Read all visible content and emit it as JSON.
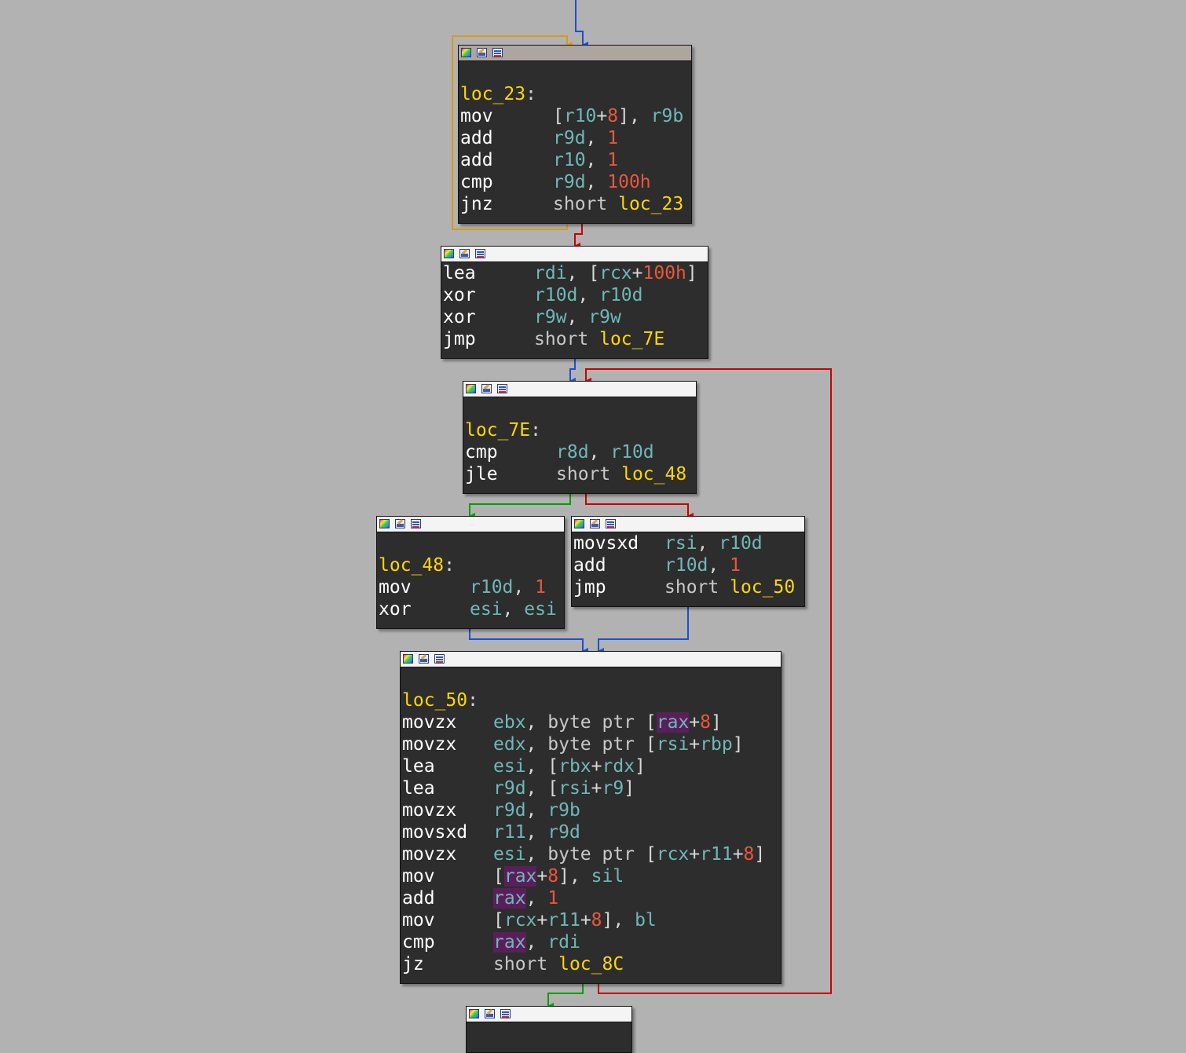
{
  "colors": {
    "background": "#b2b2b2",
    "node_bg": "#2d2d2d",
    "label": "#ffd700",
    "register": "#6fb8b8",
    "number": "#e8583a",
    "edge_true": "#00a000",
    "edge_false": "#cc0000",
    "edge_normal": "#1a4fd8",
    "edge_back": "#d89a1a",
    "highlight": "#5a1f5a"
  },
  "header_icons": [
    "graph-color-icon",
    "edit-node-icon",
    "node-list-icon"
  ],
  "nodes": [
    {
      "name": "node-loc-23",
      "header_active": true,
      "label": "loc_23",
      "lines": [
        {
          "mnemonic": "mov",
          "operands": [
            [
              "p",
              "["
            ],
            [
              "r",
              "r10"
            ],
            [
              "p",
              "+"
            ],
            [
              "n",
              "8"
            ],
            [
              "p",
              "], "
            ],
            [
              "r",
              "r9b"
            ]
          ]
        },
        {
          "mnemonic": "add",
          "operands": [
            [
              "r",
              "r9d"
            ],
            [
              "p",
              ", "
            ],
            [
              "n",
              "1"
            ]
          ]
        },
        {
          "mnemonic": "add",
          "operands": [
            [
              "r",
              "r10"
            ],
            [
              "p",
              ", "
            ],
            [
              "n",
              "1"
            ]
          ]
        },
        {
          "mnemonic": "cmp",
          "operands": [
            [
              "r",
              "r9d"
            ],
            [
              "p",
              ", "
            ],
            [
              "n",
              "100h"
            ]
          ]
        },
        {
          "mnemonic": "jnz",
          "operands": [
            [
              "k",
              "short "
            ],
            [
              "l",
              "loc_23"
            ]
          ]
        }
      ]
    },
    {
      "name": "node-setup",
      "header_active": false,
      "label": "",
      "lines": [
        {
          "mnemonic": "lea",
          "operands": [
            [
              "r",
              "rdi"
            ],
            [
              "p",
              ", ["
            ],
            [
              "r",
              "rcx"
            ],
            [
              "p",
              "+"
            ],
            [
              "n",
              "100h"
            ],
            [
              "p",
              "]"
            ]
          ]
        },
        {
          "mnemonic": "xor",
          "operands": [
            [
              "r",
              "r10d"
            ],
            [
              "p",
              ", "
            ],
            [
              "r",
              "r10d"
            ]
          ]
        },
        {
          "mnemonic": "xor",
          "operands": [
            [
              "r",
              "r9w"
            ],
            [
              "p",
              ", "
            ],
            [
              "r",
              "r9w"
            ]
          ]
        },
        {
          "mnemonic": "jmp",
          "operands": [
            [
              "k",
              "short "
            ],
            [
              "l",
              "loc_7E"
            ]
          ]
        }
      ]
    },
    {
      "name": "node-loc-7e",
      "header_active": false,
      "label": "loc_7E",
      "lines": [
        {
          "mnemonic": "cmp",
          "operands": [
            [
              "r",
              "r8d"
            ],
            [
              "p",
              ", "
            ],
            [
              "r",
              "r10d"
            ]
          ]
        },
        {
          "mnemonic": "jle",
          "operands": [
            [
              "k",
              "short "
            ],
            [
              "l",
              "loc_48"
            ]
          ]
        }
      ]
    },
    {
      "name": "node-loc-48",
      "header_active": false,
      "label": "loc_48",
      "lines": [
        {
          "mnemonic": "mov",
          "operands": [
            [
              "r",
              "r10d"
            ],
            [
              "p",
              ", "
            ],
            [
              "n",
              "1"
            ]
          ]
        },
        {
          "mnemonic": "xor",
          "operands": [
            [
              "r",
              "esi"
            ],
            [
              "p",
              ", "
            ],
            [
              "r",
              "esi"
            ]
          ]
        }
      ]
    },
    {
      "name": "node-increment",
      "header_active": false,
      "label": "",
      "lines": [
        {
          "mnemonic": "movsxd",
          "operands": [
            [
              "r",
              "rsi"
            ],
            [
              "p",
              ", "
            ],
            [
              "r",
              "r10d"
            ]
          ]
        },
        {
          "mnemonic": "add",
          "operands": [
            [
              "r",
              "r10d"
            ],
            [
              "p",
              ", "
            ],
            [
              "n",
              "1"
            ]
          ]
        },
        {
          "mnemonic": "jmp",
          "operands": [
            [
              "k",
              "short "
            ],
            [
              "l",
              "loc_50"
            ]
          ]
        }
      ]
    },
    {
      "name": "node-loc-50",
      "header_active": false,
      "label": "loc_50",
      "lines": [
        {
          "mnemonic": "movzx",
          "operands": [
            [
              "r",
              "ebx"
            ],
            [
              "p",
              ", "
            ],
            [
              "k",
              "byte ptr "
            ],
            [
              "p",
              "["
            ],
            [
              "h",
              "rax"
            ],
            [
              "p",
              "+"
            ],
            [
              "n",
              "8"
            ],
            [
              "p",
              "]"
            ]
          ]
        },
        {
          "mnemonic": "movzx",
          "operands": [
            [
              "r",
              "edx"
            ],
            [
              "p",
              ", "
            ],
            [
              "k",
              "byte ptr "
            ],
            [
              "p",
              "["
            ],
            [
              "r",
              "rsi"
            ],
            [
              "p",
              "+"
            ],
            [
              "r",
              "rbp"
            ],
            [
              "p",
              "]"
            ]
          ]
        },
        {
          "mnemonic": "lea",
          "operands": [
            [
              "r",
              "esi"
            ],
            [
              "p",
              ", ["
            ],
            [
              "r",
              "rbx"
            ],
            [
              "p",
              "+"
            ],
            [
              "r",
              "rdx"
            ],
            [
              "p",
              "]"
            ]
          ]
        },
        {
          "mnemonic": "lea",
          "operands": [
            [
              "r",
              "r9d"
            ],
            [
              "p",
              ", ["
            ],
            [
              "r",
              "rsi"
            ],
            [
              "p",
              "+"
            ],
            [
              "r",
              "r9"
            ],
            [
              "p",
              "]"
            ]
          ]
        },
        {
          "mnemonic": "movzx",
          "operands": [
            [
              "r",
              "r9d"
            ],
            [
              "p",
              ", "
            ],
            [
              "r",
              "r9b"
            ]
          ]
        },
        {
          "mnemonic": "movsxd",
          "operands": [
            [
              "r",
              "r11"
            ],
            [
              "p",
              ", "
            ],
            [
              "r",
              "r9d"
            ]
          ]
        },
        {
          "mnemonic": "movzx",
          "operands": [
            [
              "r",
              "esi"
            ],
            [
              "p",
              ", "
            ],
            [
              "k",
              "byte ptr "
            ],
            [
              "p",
              "["
            ],
            [
              "r",
              "rcx"
            ],
            [
              "p",
              "+"
            ],
            [
              "r",
              "r11"
            ],
            [
              "p",
              "+"
            ],
            [
              "n",
              "8"
            ],
            [
              "p",
              "]"
            ]
          ]
        },
        {
          "mnemonic": "mov",
          "operands": [
            [
              "p",
              "["
            ],
            [
              "h",
              "rax"
            ],
            [
              "p",
              "+"
            ],
            [
              "n",
              "8"
            ],
            [
              "p",
              "], "
            ],
            [
              "r",
              "sil"
            ]
          ]
        },
        {
          "mnemonic": "add",
          "operands": [
            [
              "h",
              "rax"
            ],
            [
              "p",
              ", "
            ],
            [
              "n",
              "1"
            ]
          ]
        },
        {
          "mnemonic": "mov",
          "operands": [
            [
              "p",
              "["
            ],
            [
              "r",
              "rcx"
            ],
            [
              "p",
              "+"
            ],
            [
              "r",
              "r11"
            ],
            [
              "p",
              "+"
            ],
            [
              "n",
              "8"
            ],
            [
              "p",
              "], "
            ],
            [
              "r",
              "bl"
            ]
          ]
        },
        {
          "mnemonic": "cmp",
          "operands": [
            [
              "h",
              "rax"
            ],
            [
              "p",
              ", "
            ],
            [
              "r",
              "rdi"
            ]
          ]
        },
        {
          "mnemonic": "jz",
          "operands": [
            [
              "k",
              "short "
            ],
            [
              "l",
              "loc_8C"
            ]
          ]
        }
      ]
    },
    {
      "name": "node-loc-8c",
      "header_active": false,
      "label": "",
      "lines": []
    }
  ]
}
